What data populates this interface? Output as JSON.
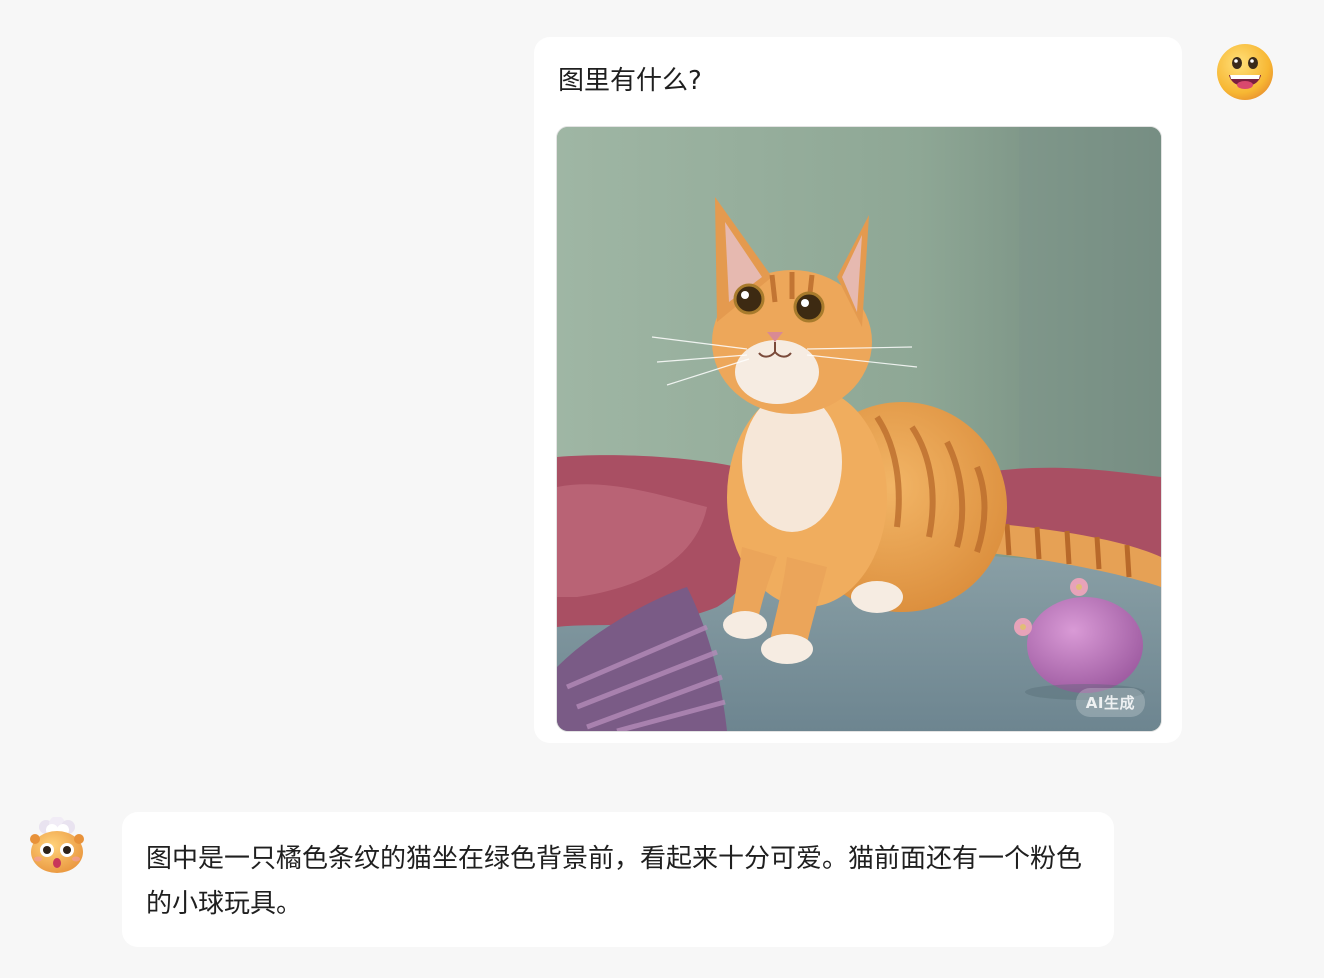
{
  "conversation": {
    "user_message": {
      "text": "图里有什么?",
      "image": {
        "subject": "orange tabby cat",
        "badge_text": "AI生成"
      },
      "avatar_icon": "grinning-face-emoji-icon"
    },
    "bot_message": {
      "text": "图中是一只橘色条纹的猫坐在绿色背景前，看起来十分可爱。猫前面还有一个粉色的小球玩具。",
      "avatar_icon": "mind-blown-bear-emoji-icon"
    }
  },
  "colors": {
    "page_background": "#f7f7f7",
    "bubble_background": "#ffffff",
    "text": "#1f1f1f"
  }
}
